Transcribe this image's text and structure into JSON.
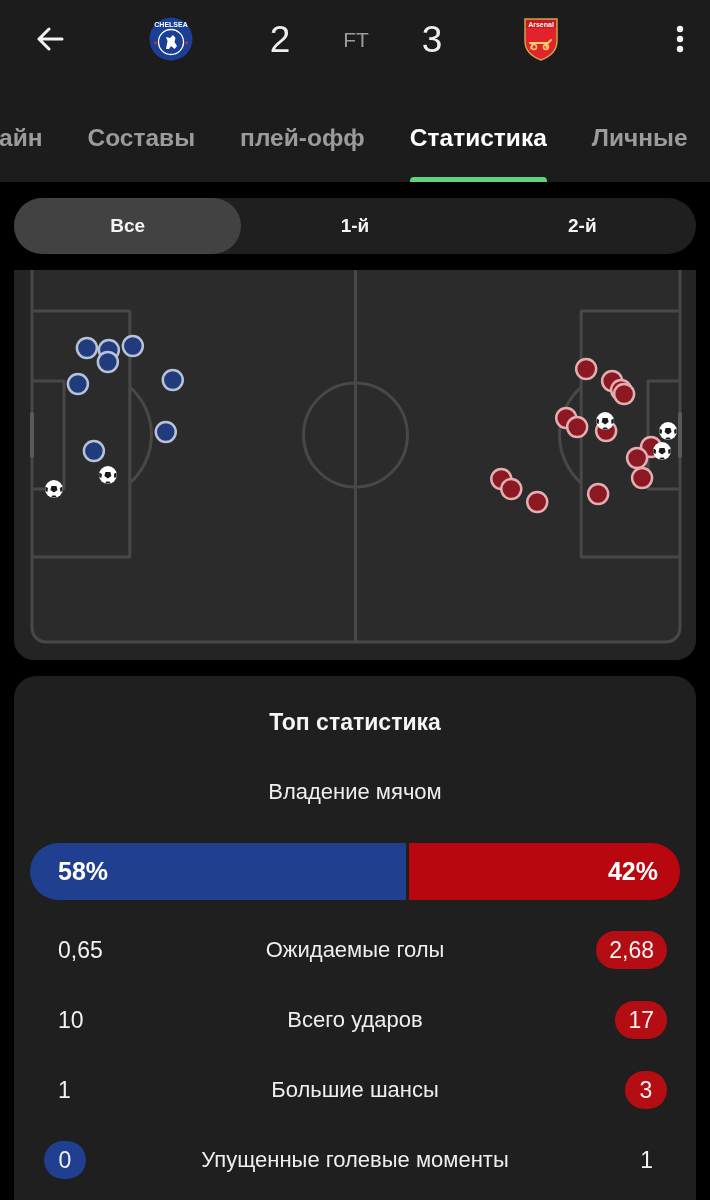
{
  "header": {
    "home_crest_text": "CHELSEA",
    "home_score": "2",
    "status": "FT",
    "away_score": "3",
    "away_crest_text": "Arsenal"
  },
  "tabs": [
    {
      "label": "айн",
      "selected": false
    },
    {
      "label": "Составы",
      "selected": false
    },
    {
      "label": "плей-офф",
      "selected": false
    },
    {
      "label": "Статистика",
      "selected": true
    },
    {
      "label": "Личные",
      "selected": false
    }
  ],
  "periods": [
    {
      "label": "Все",
      "selected": true
    },
    {
      "label": "1-й",
      "selected": false
    },
    {
      "label": "2-й",
      "selected": false
    }
  ],
  "top_stats": {
    "title": "Топ статистика",
    "possession": {
      "label": "Владение мячом",
      "home": "58%",
      "away": "42%",
      "level": 0.58
    },
    "rows": [
      {
        "label": "Ожидаемые голы",
        "home": {
          "value": "0,65",
          "highlighted": false
        },
        "away": {
          "value": "2,68",
          "highlighted": true
        }
      },
      {
        "label": "Всего ударов",
        "home": {
          "value": "10",
          "highlighted": false
        },
        "away": {
          "value": "17",
          "highlighted": true
        }
      },
      {
        "label": "Большие шансы",
        "home": {
          "value": "1",
          "highlighted": false
        },
        "away": {
          "value": "3",
          "highlighted": true
        }
      },
      {
        "label": "Упущенные голевые моменты",
        "home": {
          "value": "0",
          "highlighted": true
        },
        "away": {
          "value": "1",
          "highlighted": false
        }
      }
    ]
  }
}
